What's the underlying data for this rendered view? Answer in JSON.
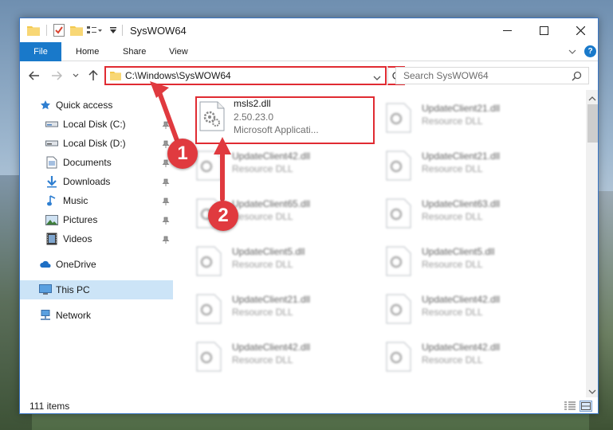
{
  "window": {
    "title": "SysWOW64",
    "controls": {
      "minimize": "—",
      "maximize": "☐",
      "close": "✕"
    }
  },
  "ribbon": {
    "tabs": [
      "File",
      "Home",
      "Share",
      "View"
    ],
    "help": "?"
  },
  "address": {
    "path": "C:\\Windows\\SysWOW64"
  },
  "search": {
    "placeholder": "Search SysWOW64"
  },
  "sidebar": {
    "items": [
      {
        "label": "Quick access",
        "icon": "star-icon",
        "pinned": false
      },
      {
        "label": "Local Disk (C:)",
        "icon": "drive-icon",
        "pinned": true
      },
      {
        "label": "Local Disk (D:)",
        "icon": "drive-icon",
        "pinned": true
      },
      {
        "label": "Documents",
        "icon": "documents-icon",
        "pinned": true
      },
      {
        "label": "Downloads",
        "icon": "downloads-icon",
        "pinned": true
      },
      {
        "label": "Music",
        "icon": "music-icon",
        "pinned": true
      },
      {
        "label": "Pictures",
        "icon": "pictures-icon",
        "pinned": true
      },
      {
        "label": "Videos",
        "icon": "videos-icon",
        "pinned": true
      },
      {
        "label": "OneDrive",
        "icon": "onedrive-icon",
        "pinned": false
      },
      {
        "label": "This PC",
        "icon": "computer-icon",
        "pinned": false,
        "selected": true
      },
      {
        "label": "Network",
        "icon": "network-icon",
        "pinned": false
      }
    ]
  },
  "files": {
    "highlighted": {
      "name": "msls2.dll",
      "version": "2.50.23.0",
      "description": "Microsoft Applicati..."
    },
    "others": [
      {
        "name": "UpdateClient21.dll",
        "type": "Resource DLL"
      },
      {
        "name": "UpdateClient42.dll",
        "type": "Resource DLL"
      },
      {
        "name": "UpdateClient21.dll",
        "type": "Resource DLL"
      },
      {
        "name": "UpdateClient65.dll",
        "type": "Resource DLL"
      },
      {
        "name": "UpdateClient63.dll",
        "type": "Resource DLL"
      },
      {
        "name": "UpdateClient5.dll",
        "type": "Resource DLL"
      },
      {
        "name": "UpdateClient5.dll",
        "type": "Resource DLL"
      },
      {
        "name": "UpdateClient21.dll",
        "type": "Resource DLL"
      },
      {
        "name": "UpdateClient42.dll",
        "type": "Resource DLL"
      },
      {
        "name": "UpdateClient42.dll",
        "type": "Resource DLL"
      },
      {
        "name": "UpdateClient42.dll",
        "type": "Resource DLL"
      }
    ]
  },
  "status": {
    "item_count": "111 items"
  },
  "annotations": {
    "step1": "1",
    "step2": "2"
  },
  "colors": {
    "accent": "#1979ca",
    "highlight": "#e02b32",
    "selected": "#cce4f7"
  }
}
